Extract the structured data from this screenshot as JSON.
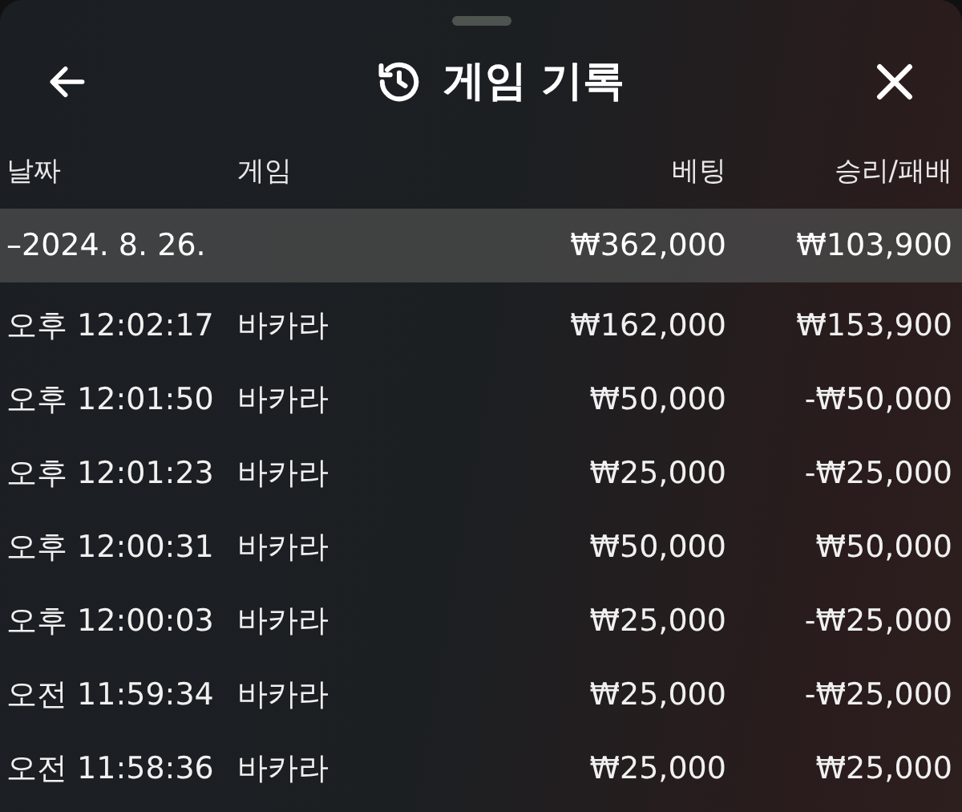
{
  "header": {
    "title": "게임 기록"
  },
  "columns": [
    "날짜",
    "게임",
    "베팅",
    "승리/패배"
  ],
  "group": {
    "date": "–2024. 8. 26.",
    "bet": "₩362,000",
    "result": "₩103,900"
  },
  "rows": [
    {
      "time": "오후 12:02:17",
      "game": "바카라",
      "bet": "₩162,000",
      "result": "₩153,900"
    },
    {
      "time": "오후 12:01:50",
      "game": "바카라",
      "bet": "₩50,000",
      "result": "-₩50,000"
    },
    {
      "time": "오후 12:01:23",
      "game": "바카라",
      "bet": "₩25,000",
      "result": "-₩25,000"
    },
    {
      "time": "오후 12:00:31",
      "game": "바카라",
      "bet": "₩50,000",
      "result": "₩50,000"
    },
    {
      "time": "오후 12:00:03",
      "game": "바카라",
      "bet": "₩25,000",
      "result": "-₩25,000"
    },
    {
      "time": "오전 11:59:34",
      "game": "바카라",
      "bet": "₩25,000",
      "result": "-₩25,000"
    },
    {
      "time": "오전 11:58:36",
      "game": "바카라",
      "bet": "₩25,000",
      "result": "₩25,000"
    }
  ]
}
